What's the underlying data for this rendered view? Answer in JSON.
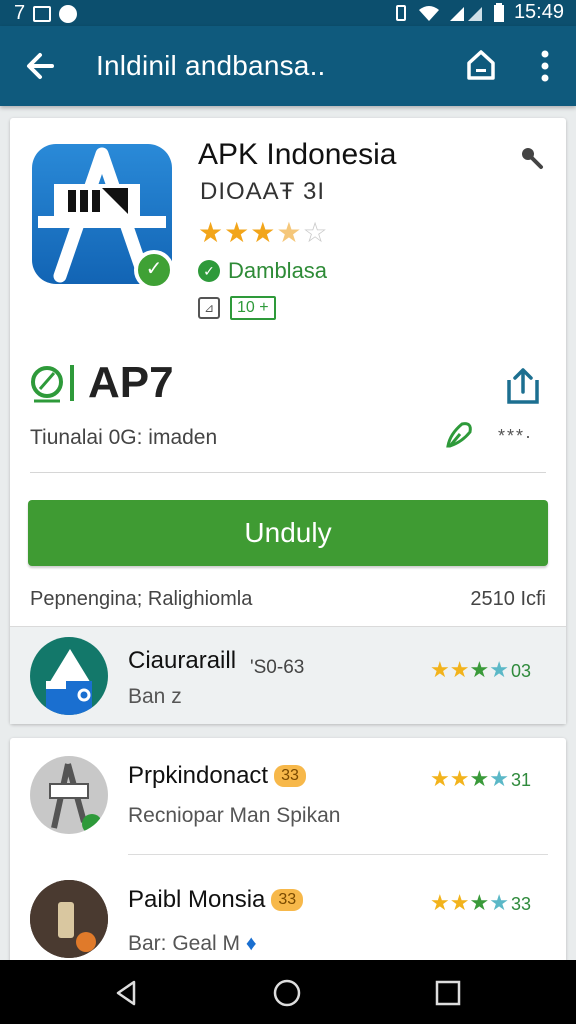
{
  "status_bar": {
    "left_text": "7",
    "time": "15:49"
  },
  "toolbar": {
    "title": "Inldinil andbansa.."
  },
  "app": {
    "name": "APK Indonesia",
    "developer": "DIOAAŦ 3I",
    "rating_stars": 3.5,
    "verified_text": "Damblasa",
    "age_rating": "10 +"
  },
  "brand": {
    "name": "AP7"
  },
  "description": {
    "text": "Tiunalai 0G: imaden",
    "rating_dots": "***·"
  },
  "install": {
    "label": "Unduly"
  },
  "meta": {
    "left": "Pepnengina;  Ralighiomla",
    "right": "2510 Icfi"
  },
  "related": [
    {
      "title": "Ciauraraill",
      "code": "'S0-63",
      "subtitle": "Ban z",
      "rating_count": "03"
    },
    {
      "title": "Prpkindonact",
      "badge": "33",
      "subtitle": "Recniopar Man Spikan",
      "rating_count": "31"
    },
    {
      "title": "Paibl Monsia",
      "badge": "33",
      "subtitle": "Bar: Geal M",
      "rating_count": "33"
    }
  ],
  "colors": {
    "appbar": "#0f5a7d",
    "status_bar": "#0c4f6e",
    "install": "#3f9b33",
    "star": "#f2a51a"
  },
  "icons": [
    "back-arrow-icon",
    "home-icon",
    "more-vert-icon",
    "search-icon",
    "share-icon",
    "edit-icon",
    "verified-check-icon"
  ]
}
